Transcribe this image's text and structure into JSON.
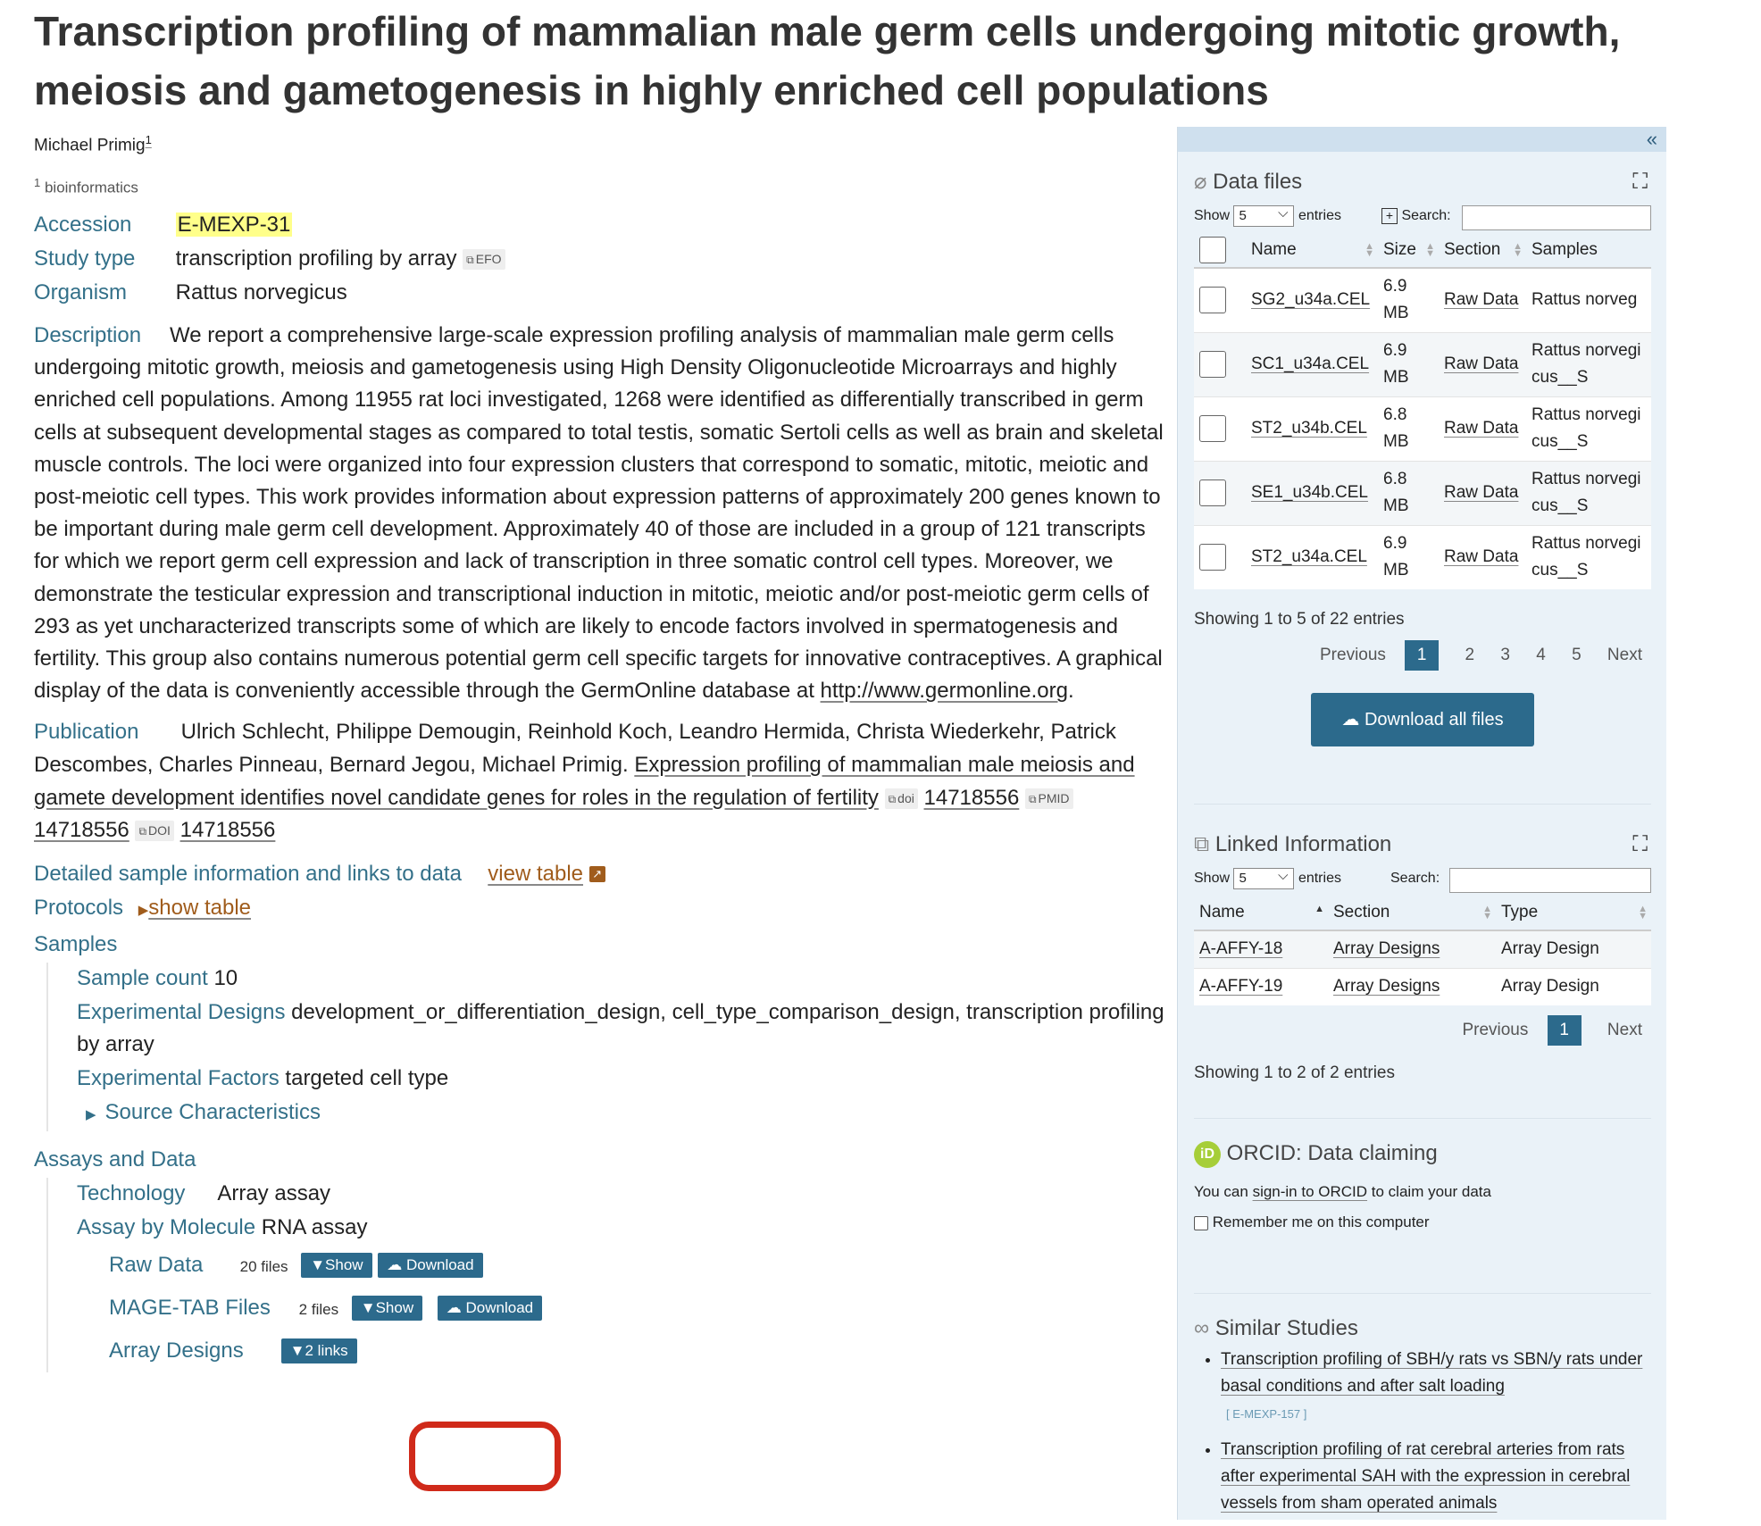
{
  "title": "Transcription profiling of mammalian male germ cells undergoing mitotic growth, meiosis and gametogenesis in highly enriched cell populations",
  "author": "Michael Primig",
  "author_sup": "1",
  "affiliation_sup": "1",
  "affiliation": "bioinformatics",
  "accession": {
    "label": "Accession",
    "value": "E-MEXP-31"
  },
  "study_type": {
    "label": "Study type",
    "value": "transcription profiling by array",
    "tag": "EFO"
  },
  "organism": {
    "label": "Organism",
    "value": "Rattus norvegicus"
  },
  "description": {
    "label": "Description",
    "text": "We report a comprehensive large-scale expression profiling analysis of mammalian male germ cells undergoing mitotic growth, meiosis and gametogenesis using High Density Oligonucleotide Microarrays and highly enriched cell populations. Among 11955 rat loci investigated, 1268 were identified as differentially transcribed in germ cells at subsequent developmental stages as compared to total testis, somatic Sertoli cells as well as brain and skeletal muscle controls. The loci were organized into four expression clusters that correspond to somatic, mitotic, meiotic and post-meiotic cell types. This work provides information about expression patterns of approximately 200 genes known to be important during male germ cell development. Approximately 40 of those are included in a group of 121 transcripts for which we report germ cell expression and lack of transcription in three somatic control cell types. Moreover, we demonstrate the testicular expression and transcriptional induction in mitotic, meiotic and/or post-meiotic germ cells of 293 as yet uncharacterized transcripts some of which are likely to encode factors involved in spermatogenesis and fertility. This group also contains numerous potential germ cell specific targets for innovative contraceptives. A graphical display of the data is conveniently accessible through the GermOnline database at",
    "link": "http://www.germonline.org",
    "end": "."
  },
  "publication": {
    "label": "Publication",
    "authors": "Ulrich Schlecht, Philippe Demougin, Reinhold Koch, Leandro Hermida, Christa Wiederkehr, Patrick Descombes, Charles Pinneau, Bernard Jegou, Michael Primig.",
    "title_link": "Expression profiling of mammalian male meiosis and gamete development identifies novel candidate genes for roles in the regulation of fertility",
    "doi_tag": "doi",
    "doi_id": "14718556",
    "pmid_tag": "PMID",
    "pmid_id": "14718556",
    "doi2_tag": "DOI",
    "doi2_id": "14718556"
  },
  "sample_info": {
    "label": "Detailed sample information and links to data",
    "link": "view table"
  },
  "protocols": {
    "label": "Protocols",
    "link": "show table"
  },
  "samples": {
    "label": "Samples",
    "count_label": "Sample count",
    "count": "10",
    "designs_label": "Experimental Designs",
    "designs": "development_or_differentiation_design, cell_type_comparison_design, transcription profiling by array",
    "factors_label": "Experimental Factors",
    "factors": "targeted cell type",
    "source_label": "Source Characteristics"
  },
  "assays": {
    "label": "Assays and Data",
    "technology_label": "Technology",
    "technology": "Array assay",
    "molecule_label": "Assay by Molecule",
    "molecule": "RNA assay",
    "raw": {
      "label": "Raw Data",
      "files": "20 files",
      "show": "Show",
      "download": "Download"
    },
    "magetab": {
      "label": "MAGE-TAB Files",
      "files": "2 files",
      "show": "Show",
      "download": "Download"
    },
    "array": {
      "label": "Array Designs",
      "links": "2 links"
    }
  },
  "data_files": {
    "title": "Data files",
    "show": "Show",
    "entries_value": "5",
    "entries": "entries",
    "search": "Search:",
    "columns": [
      "Name",
      "Size",
      "Section",
      "Samples"
    ],
    "rows": [
      {
        "name": "SG2_u34a.CEL",
        "size": "6.9 MB",
        "section": "Raw Data",
        "samples": "Rattus norveg"
      },
      {
        "name": "SC1_u34a.CEL",
        "size": "6.9 MB",
        "section": "Raw Data",
        "samples": "Rattus norvegicus__S"
      },
      {
        "name": "ST2_u34b.CEL",
        "size": "6.8 MB",
        "section": "Raw Data",
        "samples": "Rattus norvegicus__S"
      },
      {
        "name": "SE1_u34b.CEL",
        "size": "6.8 MB",
        "section": "Raw Data",
        "samples": "Rattus norvegicus__S"
      },
      {
        "name": "ST2_u34a.CEL",
        "size": "6.9 MB",
        "section": "Raw Data",
        "samples": "Rattus norvegicus__S"
      }
    ],
    "info": "Showing 1 to 5 of 22 entries",
    "pager": {
      "prev": "Previous",
      "pages": [
        "1",
        "2",
        "3",
        "4",
        "5"
      ],
      "next": "Next"
    },
    "download_all": "Download all files"
  },
  "linked": {
    "title": "Linked Information",
    "show": "Show",
    "entries_value": "5",
    "entries": "entries",
    "search": "Search:",
    "columns": [
      "Name",
      "Section",
      "Type"
    ],
    "rows": [
      {
        "name": "A-AFFY-18",
        "section": "Array Designs",
        "type": "Array Design"
      },
      {
        "name": "A-AFFY-19",
        "section": "Array Designs",
        "type": "Array Design"
      }
    ],
    "pager": {
      "prev": "Previous",
      "page": "1",
      "next": "Next"
    },
    "info": "Showing 1 to 2 of 2 entries"
  },
  "orcid": {
    "icon": "iD",
    "title": "ORCID: Data claiming",
    "text_pre": "You can",
    "link": "sign-in to ORCID",
    "text_post": "to claim your data",
    "remember": "Remember me on this computer"
  },
  "similar": {
    "title": "Similar Studies",
    "items": [
      {
        "title": "Transcription profiling of SBH/y rats vs SBN/y rats under basal conditions and after salt loading",
        "acc": "[ E-MEXP-157 ]"
      },
      {
        "title": "Transcription profiling of rat cerebral arteries from rats after experimental SAH with the expression in cerebral vessels from sham operated animals",
        "acc": ""
      }
    ]
  },
  "colors": {
    "accent": "#2c6a8c",
    "label": "#337089",
    "highlight": "#ffff8a",
    "ring": "#d02a1a",
    "orcid": "#a6ce39"
  }
}
